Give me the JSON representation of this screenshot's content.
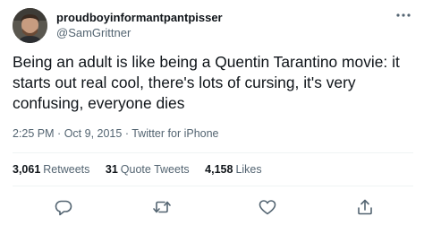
{
  "user": {
    "display_name": "proudboyinformantpantpisser",
    "handle": "@SamGrittner"
  },
  "tweet": {
    "text": "Being an adult is like being a Quentin Tarantino movie: it starts out real cool, there's lots of cursing, it's very confusing, everyone dies",
    "time": "2:25 PM",
    "date": "Oct 9, 2015",
    "separator": "·",
    "source": "Twitter for iPhone"
  },
  "stats": {
    "retweets_count": "3,061",
    "retweets_label": "Retweets",
    "quotes_count": "31",
    "quotes_label": "Quote Tweets",
    "likes_count": "4,158",
    "likes_label": "Likes"
  },
  "icons": {
    "more": "more-icon",
    "reply": "reply-icon",
    "retweet": "retweet-icon",
    "like": "heart-icon",
    "share": "share-icon"
  },
  "colors": {
    "text_primary": "#0f1419",
    "text_secondary": "#536471",
    "divider": "#eff3f4"
  }
}
